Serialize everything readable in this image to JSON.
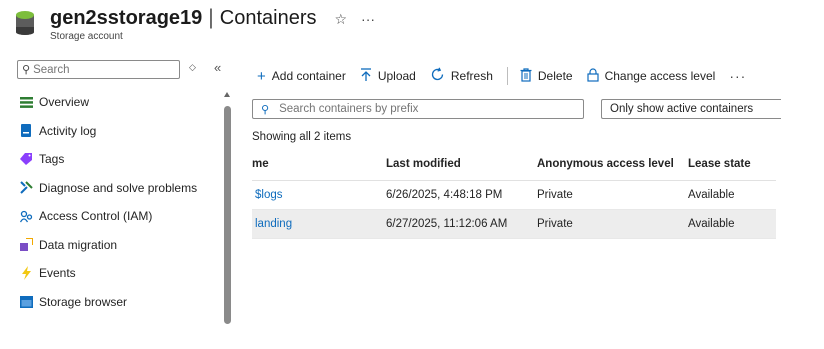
{
  "header": {
    "resource_name": "gen2sstorage19",
    "separator": "|",
    "page_title": "Containers",
    "subtitle": "Storage account",
    "favorite_icon": "☆",
    "more_icon": "···"
  },
  "sidebar": {
    "search_placeholder": "Search",
    "items": [
      {
        "label": "Overview",
        "icon": "overview-icon",
        "color": "#2e7d32"
      },
      {
        "label": "Activity log",
        "icon": "activity-log-icon",
        "color": "#0f6cbd"
      },
      {
        "label": "Tags",
        "icon": "tag-icon",
        "color": "#8a3ffc"
      },
      {
        "label": "Diagnose and solve problems",
        "icon": "wrench-icon",
        "color": "#0f6cbd"
      },
      {
        "label": "Access Control (IAM)",
        "icon": "iam-icon",
        "color": "#0f6cbd"
      },
      {
        "label": "Data migration",
        "icon": "data-migration-icon",
        "color": "#7a4dc5"
      },
      {
        "label": "Events",
        "icon": "lightning-icon",
        "color": "#f2c811"
      },
      {
        "label": "Storage browser",
        "icon": "storage-browser-icon",
        "color": "#0f6cbd"
      }
    ]
  },
  "toolbar": {
    "add_container": "Add container",
    "upload": "Upload",
    "refresh": "Refresh",
    "delete": "Delete",
    "change_access_level": "Change access level",
    "more": "···"
  },
  "filters": {
    "search_placeholder": "Search containers by prefix",
    "active_filter": "Only show active containers"
  },
  "status": {
    "showing_text": "Showing all 2 items"
  },
  "table": {
    "columns": [
      "me",
      "Last modified",
      "Anonymous access level",
      "Lease state"
    ],
    "rows": [
      {
        "name": "$logs",
        "last_modified": "6/26/2025, 4:48:18 PM",
        "access": "Private",
        "lease": "Available"
      },
      {
        "name": "landing",
        "last_modified": "6/27/2025, 11:12:06 AM",
        "access": "Private",
        "lease": "Available"
      }
    ]
  },
  "colors": {
    "accent": "#0f6cbd",
    "selected_row": "#ededed"
  }
}
